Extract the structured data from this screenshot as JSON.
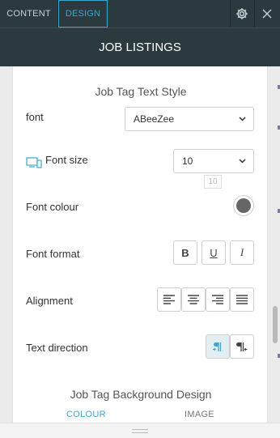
{
  "tabs": [
    {
      "label": "CONTENT",
      "active": false
    },
    {
      "label": "DESIGN",
      "active": true
    }
  ],
  "icons": {
    "settings": "gear-icon",
    "close": "close-icon"
  },
  "panel_title": "JOB LISTINGS",
  "section_text_style": "Job Tag Text Style",
  "font": {
    "label": "font",
    "value": "ABeeZee"
  },
  "font_size": {
    "label": "Font size",
    "value": "10",
    "tooltip": "10"
  },
  "font_colour": {
    "label": "Font colour",
    "value": "#666666"
  },
  "font_format": {
    "label": "Font format",
    "bold": "B",
    "underline": "U",
    "italic": "I"
  },
  "alignment": {
    "label": "Alignment",
    "options": [
      "left",
      "center",
      "right",
      "justify"
    ]
  },
  "text_direction": {
    "label": "Text direction",
    "options": [
      "ltr",
      "rtl"
    ],
    "selected": "ltr"
  },
  "section_bg": "Job Tag Background Design",
  "bg_tabs": {
    "colour": "COLOUR",
    "image": "IMAGE",
    "active": "COLOUR"
  },
  "colors": {
    "header_bg": "#2b3a3f",
    "accent": "#3ea6cf",
    "panel_bg": "#ebebeb"
  }
}
